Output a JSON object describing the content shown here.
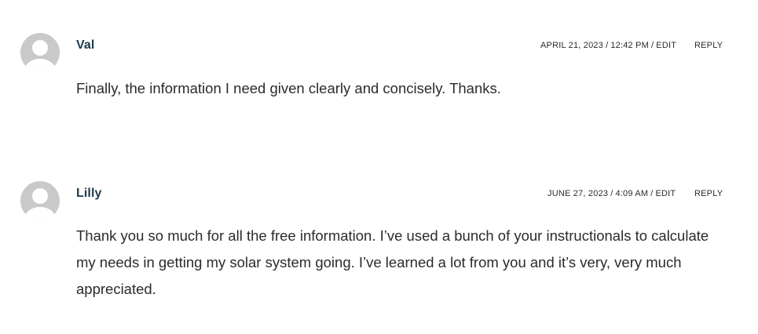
{
  "comments": [
    {
      "author": "Val",
      "date": "APRIL 21, 2023",
      "time": "12:42 PM",
      "edit_label": "EDIT",
      "reply_label": "REPLY",
      "text": "Finally, the information I need given clearly and concisely. Thanks."
    },
    {
      "author": "Lilly",
      "date": "JUNE 27, 2023",
      "time": "4:09 AM",
      "edit_label": "EDIT",
      "reply_label": "REPLY",
      "text": "Thank you so much for all the free information. I’ve used a bunch of your instructionals to calculate my needs in getting my solar system going. I’ve learned a lot from you and it’s very, very much appreciated."
    }
  ]
}
